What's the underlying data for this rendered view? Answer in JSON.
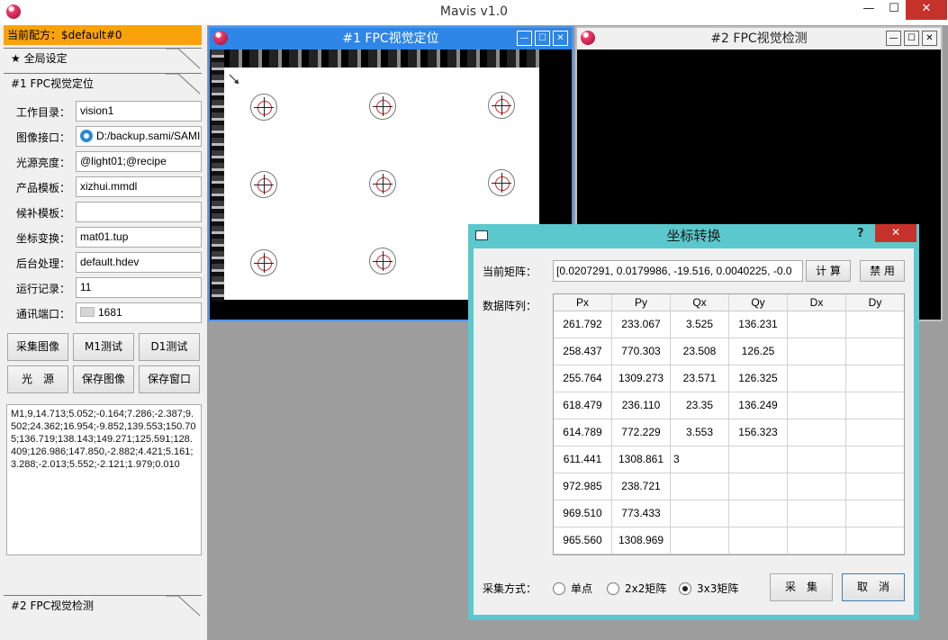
{
  "app": {
    "title": "Mavis v1.0",
    "min": "—",
    "max": "☐",
    "close": "✕"
  },
  "left": {
    "recipe": "当前配方：$default#0",
    "global_tab": "★ 全局设定",
    "vision_tab": "#1 FPC视觉定位",
    "bottom_tab": "#2 FPC视觉检测",
    "fields": [
      {
        "label": "工作目录：",
        "value": "vision1"
      },
      {
        "label": "图像接口：",
        "value": "D:/backup.sami/SAMI"
      },
      {
        "label": "光源亮度：",
        "value": "@light01;@recipe"
      },
      {
        "label": "产品模板：",
        "value": "xizhui.mmdl"
      },
      {
        "label": "候补模板：",
        "value": ""
      },
      {
        "label": "坐标变换：",
        "value": "mat01.tup"
      },
      {
        "label": "后台处理：",
        "value": "default.hdev"
      },
      {
        "label": "运行记录：",
        "value": "11"
      },
      {
        "label": "通讯端口：",
        "value": "1681"
      }
    ],
    "buttons": [
      "采集图像",
      "M1测试",
      "D1测试",
      "光　源",
      "保存图像",
      "保存窗口"
    ],
    "log": "M1,9,14.713;5.052;-0.164;7.286;-2.387;9.502;24.362;16.954;-9.852,139.553;150.705;136.719;138.143;149.271;125.591;128.409;126.986;147.850,-2.882;4.421;5.161;3.288;-2.013;5.552;-2.121;1.979;0.010"
  },
  "win1": {
    "title": "#1 FPC视觉定位",
    "min": "—",
    "max": "☐",
    "close": "✕"
  },
  "win2": {
    "title": "#2 FPC视觉检测",
    "min": "—",
    "max": "☐",
    "close": "✕"
  },
  "dialog": {
    "title": "坐标转换",
    "help": "?",
    "close": "✕",
    "matrix_label": "当前矩阵：",
    "matrix_value": "[0.0207291, 0.0179986, -19.516, 0.0040225, -0.0",
    "compute_btn": "计 算",
    "disable_btn": "禁 用",
    "grid_label": "数据阵列：",
    "columns": [
      "Px",
      "Py",
      "Qx",
      "Qy",
      "Dx",
      "Dy"
    ],
    "rows": [
      [
        "261.792",
        "233.067",
        "3.525",
        "136.231",
        "",
        ""
      ],
      [
        "258.437",
        "770.303",
        "23.508",
        "126.25",
        "",
        ""
      ],
      [
        "255.764",
        "1309.273",
        "23.571",
        "126.325",
        "",
        ""
      ],
      [
        "618.479",
        "236.110",
        "23.35",
        "136.249",
        "",
        ""
      ],
      [
        "614.789",
        "772.229",
        "3.553",
        "156.323",
        "",
        ""
      ],
      [
        "611.441",
        "1308.861",
        "3",
        "",
        "",
        ""
      ],
      [
        "972.985",
        "238.721",
        "",
        "",
        "",
        ""
      ],
      [
        "969.510",
        "773.433",
        "",
        "",
        "",
        ""
      ],
      [
        "965.560",
        "1308.969",
        "",
        "",
        "",
        ""
      ]
    ],
    "mode_label": "采集方式：",
    "modes": [
      {
        "label": "单点",
        "selected": false
      },
      {
        "label": "2x2矩阵",
        "selected": false
      },
      {
        "label": "3x3矩阵",
        "selected": true
      }
    ],
    "collect_btn": "采　集",
    "cancel_btn": "取　消"
  }
}
